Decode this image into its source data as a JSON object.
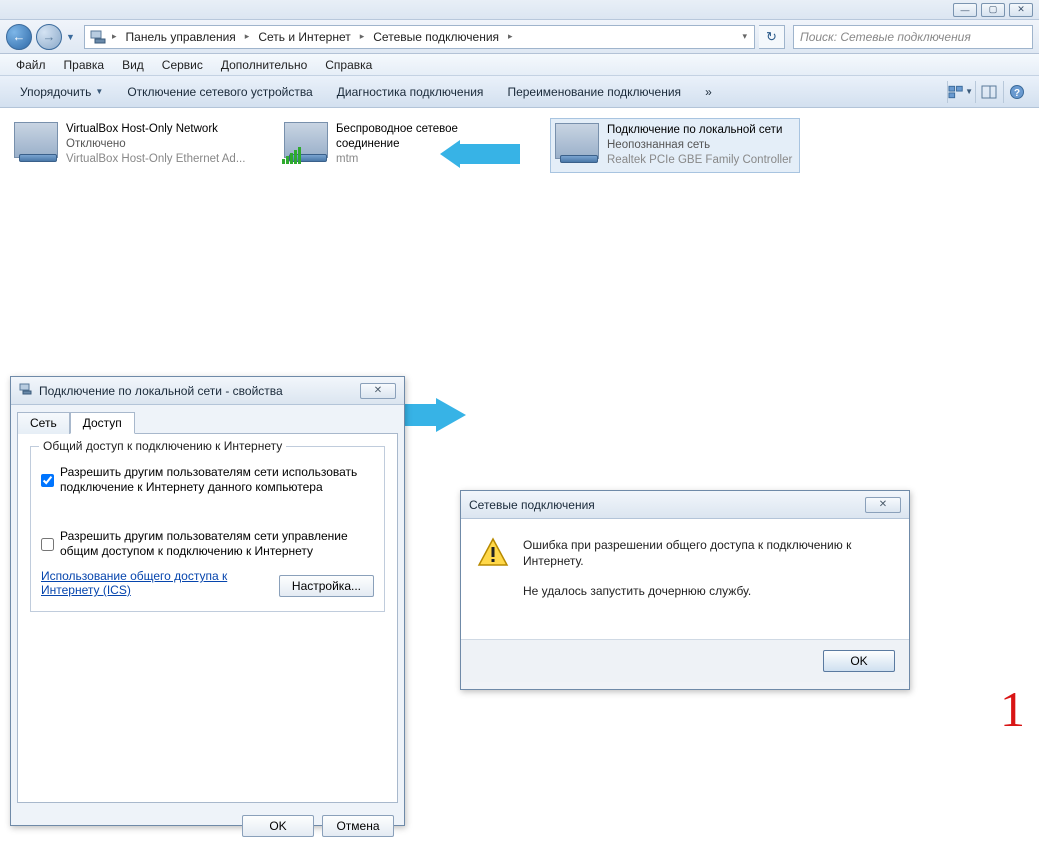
{
  "titlebar_buttons": {
    "min": "—",
    "max": "▢",
    "close": "✕"
  },
  "breadcrumb": {
    "seg1": "Панель управления",
    "seg2": "Сеть и Интернет",
    "seg3": "Сетевые подключения"
  },
  "search": {
    "placeholder": "Поиск: Сетевые подключения"
  },
  "menu": {
    "file": "Файл",
    "edit": "Правка",
    "view": "Вид",
    "service": "Сервис",
    "extra": "Дополнительно",
    "help": "Справка"
  },
  "toolbar": {
    "organize": "Упорядочить",
    "disable": "Отключение сетевого устройства",
    "diag": "Диагностика подключения",
    "rename": "Переименование подключения",
    "overflow": "»"
  },
  "adapters": [
    {
      "t1": "VirtualBox Host-Only Network",
      "t2": "Отключено",
      "t3": "VirtualBox Host-Only Ethernet Ad..."
    },
    {
      "t1": "Беспроводное сетевое",
      "t1b": "соединение",
      "t2": "mtm"
    },
    {
      "t1": "Подключение по локальной сети",
      "t2": "Неопознанная сеть",
      "t3": "Realtek PCIe GBE Family Controller"
    }
  ],
  "props": {
    "title": "Подключение по локальной сети - свойства",
    "tab_net": "Сеть",
    "tab_access": "Доступ",
    "group_title": "Общий доступ к подключению к Интернету",
    "chk1": "Разрешить другим пользователям сети использовать подключение к Интернету данного компьютера",
    "chk2": "Разрешить другим пользователям сети управление общим доступом к подключению к Интернету",
    "link": "Использование общего доступа к Интернету (ICS)",
    "settings_btn": "Настройка...",
    "ok": "OK",
    "cancel": "Отмена"
  },
  "err": {
    "title": "Сетевые подключения",
    "line1": "Ошибка при разрешении общего доступа к подключению к Интернету.",
    "line2": "Не удалось запустить дочернюю службу.",
    "ok": "OK"
  },
  "marker": "1"
}
